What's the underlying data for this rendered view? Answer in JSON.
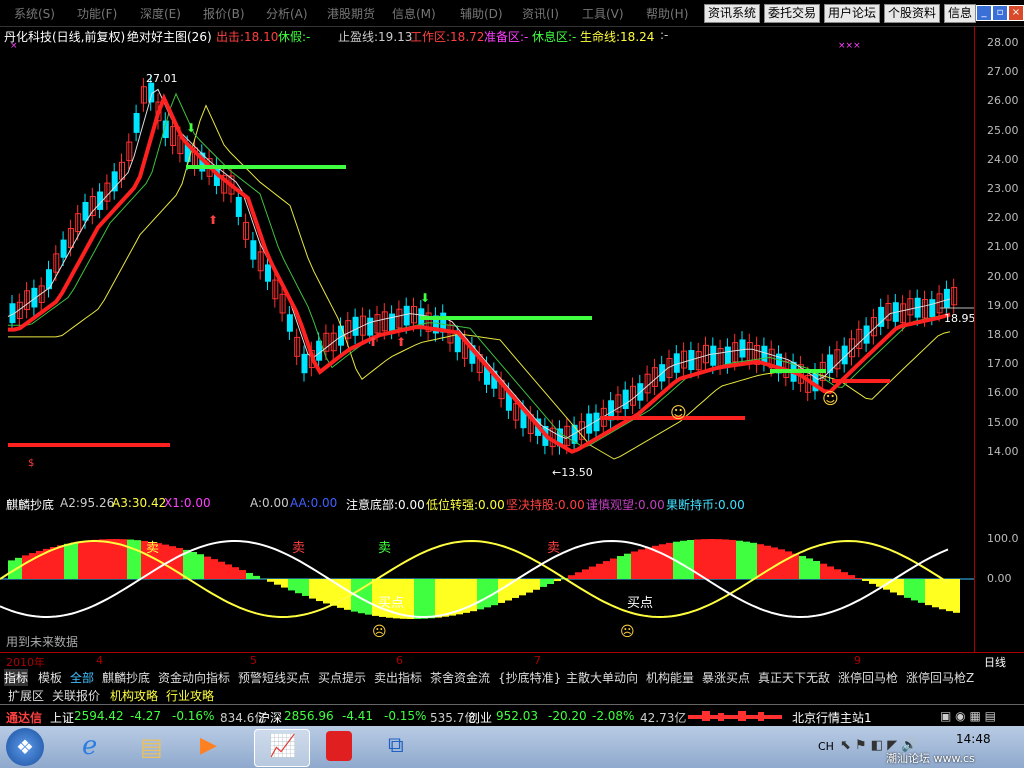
{
  "menu": [
    "系统(S)",
    "功能(F)",
    "深度(E)",
    "报价(B)",
    "分析(A)",
    "港股期货",
    "信息(M)",
    "辅助(D)",
    "资讯(I)",
    "工具(V)",
    "帮助(H)"
  ],
  "quick_buttons": [
    "资讯系统",
    "委托交易",
    "用户论坛",
    "个股资料",
    "信息"
  ],
  "info": {
    "stock": "丹化科技(日线,前复权)",
    "indicator": "绝对好主图(26)",
    "chu": "出击:18.10",
    "xiujia": "休假:-",
    "zhiying": "止盈线:19.13",
    "work": "工作区:18.72",
    "prep": "准备区:-",
    "rest": "休息区:-",
    "life": "生命线:18.24",
    "dash": ":-"
  },
  "axis_labels": [
    "28.00",
    "27.00",
    "26.00",
    "25.00",
    "24.00",
    "23.00",
    "22.00",
    "21.00",
    "20.00",
    "19.00",
    "18.00",
    "17.00",
    "16.00",
    "15.00",
    "14.00"
  ],
  "annotations": {
    "high": "27.01",
    "low": "←13.50",
    "last": "18.95"
  },
  "sub": {
    "name": "麒麟抄底",
    "a2": "A2:95.26",
    "a3": "A3:30.42",
    "x1": "X1:0.00",
    "a": "A:0.00",
    "aa": "AA:0.00",
    "zd": "注意底部:0.00",
    "dw": "低位转强:0.00",
    "jj": "坚决持股:0.00",
    "jsgw": "谨慎观望:0.00",
    "gd": "果断持币:0.00",
    "l100": "100.0",
    "l0": "0.00",
    "sell": "卖",
    "buy": "买点",
    "future": "用到未来数据"
  },
  "timeaxis": {
    "year": "2010年",
    "m4": "4",
    "m5": "5",
    "m6": "6",
    "m7": "7",
    "m9": "9",
    "period": "日线"
  },
  "tabs1": [
    "指标",
    "模板",
    "全部",
    "麒麟抄底",
    "资金动向指标",
    "预警短线买点",
    "买点提示",
    "卖出指标",
    "茶舍资金流",
    "{抄底特准}",
    "主散大单动向",
    "机构能量",
    "暴涨买点",
    "真正天下无敌",
    "涨停回马枪",
    "涨停回马枪Z"
  ],
  "tabs2": [
    "扩展区",
    "关联报价",
    "机构攻略",
    "行业攻略"
  ],
  "status": {
    "brand": "通达信",
    "sh": "上证",
    "sh_val": "2594.42",
    "sh_chg": "-4.27",
    "sh_pct": "-0.16%",
    "sh_amt": "834.6亿",
    "sz": "沪深",
    "sz_val": "2856.96",
    "sz_chg": "-4.41",
    "sz_pct": "-0.15%",
    "sz_amt": "535.7亿",
    "cy": "创业",
    "cy_val": "952.03",
    "cy_chg": "-20.20",
    "cy_pct": "-2.08%",
    "cy_amt": "42.73亿",
    "server": "北京行情主站1"
  },
  "taskbar": {
    "lang": "CH",
    "time": "14:48",
    "watermark": "潮汕论坛 www.cs"
  },
  "colors": {
    "up": "#ff3030",
    "down": "#00e5ff",
    "ma": "#ffff40",
    "green": "#40ff40"
  }
}
